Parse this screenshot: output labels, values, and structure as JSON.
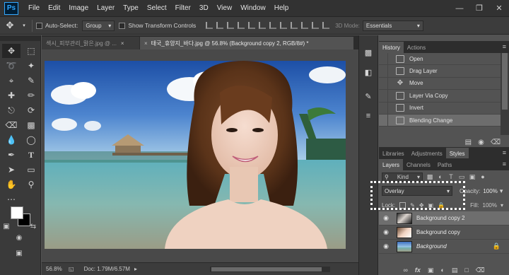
{
  "app": {
    "logo": "Ps",
    "menu": [
      "File",
      "Edit",
      "Image",
      "Layer",
      "Type",
      "Select",
      "Filter",
      "3D",
      "View",
      "Window",
      "Help"
    ]
  },
  "options": {
    "tool_icon": "move-icon",
    "auto_select_label": "Auto-Select:",
    "auto_select_value": "Group",
    "show_transform_label": "Show Transform Controls",
    "mode_3d_label": "3D Mode:",
    "workspace": "Essentials"
  },
  "document": {
    "tabs": [
      {
        "label": "섹시_피부관리_맑은.jpg @ ...",
        "active": false
      },
      {
        "label": "태국_휴양지_바다.jpg @ 56.8% (Background copy 2, RGB/8#) *",
        "active": true
      }
    ],
    "zoom": "56.8%",
    "doc_info": "Doc: 1.79M/6.57M"
  },
  "history": {
    "tabs": [
      "History",
      "Actions"
    ],
    "items": [
      {
        "label": "Open",
        "active": false
      },
      {
        "label": "Drag Layer",
        "active": false
      },
      {
        "label": "Move",
        "active": false
      },
      {
        "label": "Layer Via Copy",
        "active": false
      },
      {
        "label": "Invert",
        "active": false
      },
      {
        "label": "Blending Change",
        "active": true
      }
    ]
  },
  "library_tabs": [
    "Libraries",
    "Adjustments",
    "Styles"
  ],
  "layers": {
    "tabs": [
      "Layers",
      "Channels",
      "Paths"
    ],
    "kind_label": "Kind",
    "blend_mode": "Overlay",
    "opacity_label": "Opacity:",
    "opacity_value": "100%",
    "lock_label": "Lock:",
    "fill_label": "Fill:",
    "fill_value": "100%",
    "items": [
      {
        "name": "Background copy 2",
        "active": true,
        "italic": false
      },
      {
        "name": "Background copy",
        "active": false,
        "italic": false
      },
      {
        "name": "Background",
        "active": false,
        "italic": true
      }
    ]
  },
  "colors": {
    "foreground": "#ffffff",
    "background": "#000000",
    "accent": "#31a8ff"
  }
}
